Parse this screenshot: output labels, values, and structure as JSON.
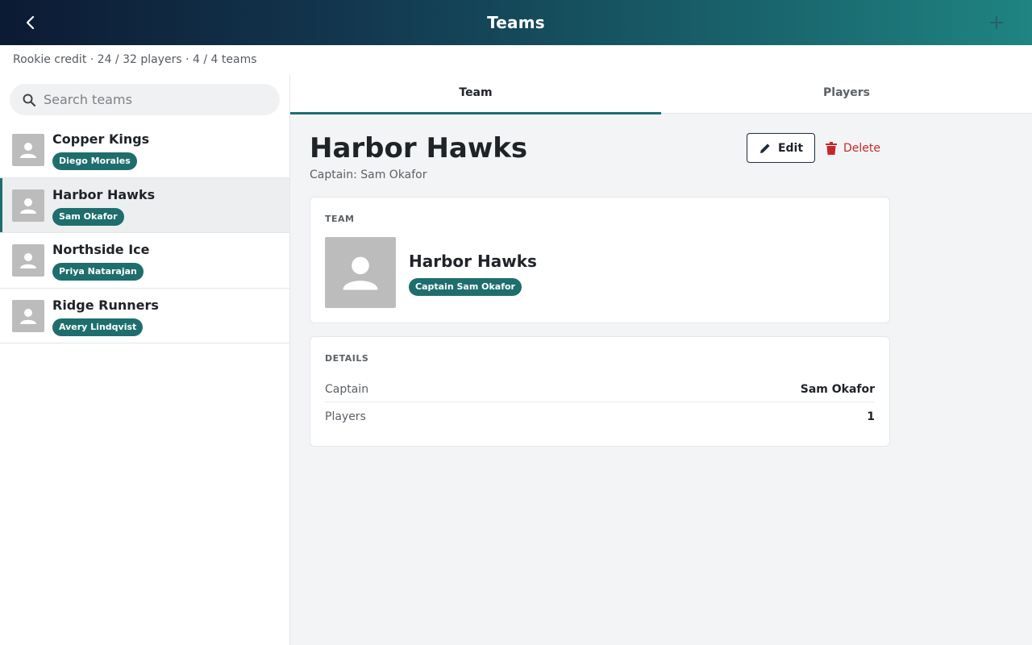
{
  "appbar": {
    "title": "Teams",
    "back_icon": "chevron-left-icon",
    "add_icon": "plus-icon"
  },
  "subbar": {
    "info": "Rookie credit · 24 / 32 players · 4 / 4 teams"
  },
  "search": {
    "placeholder": "Search teams",
    "value": ""
  },
  "teams": [
    {
      "name": "Copper Kings",
      "captain": "Diego Morales",
      "active": false
    },
    {
      "name": "Harbor Hawks",
      "captain": "Sam Okafor",
      "active": true
    },
    {
      "name": "Northside Ice",
      "captain": "Priya Natarajan",
      "active": false
    },
    {
      "name": "Ridge Runners",
      "captain": "Avery Lindqvist",
      "active": false
    }
  ],
  "tabs": [
    {
      "label": "Team",
      "active": true
    },
    {
      "label": "Players",
      "active": false
    }
  ],
  "detail": {
    "title": "Harbor Hawks",
    "subtitle": "Captain: Sam Okafor",
    "edit_label": "Edit",
    "delete_label": "Delete",
    "team_card": {
      "label": "TEAM",
      "name": "Harbor Hawks",
      "badge": "Captain Sam Okafor"
    },
    "details_card": {
      "label": "DETAILS",
      "rows": [
        {
          "key": "Captain",
          "value": "Sam Okafor"
        },
        {
          "key": "Players",
          "value": "1"
        }
      ]
    }
  },
  "colors": {
    "accent": "#1d6f6f",
    "badge": "#1e6e6d",
    "danger": "#c62828",
    "appbar_start": "#0c1a33",
    "appbar_end": "#1f8482"
  }
}
